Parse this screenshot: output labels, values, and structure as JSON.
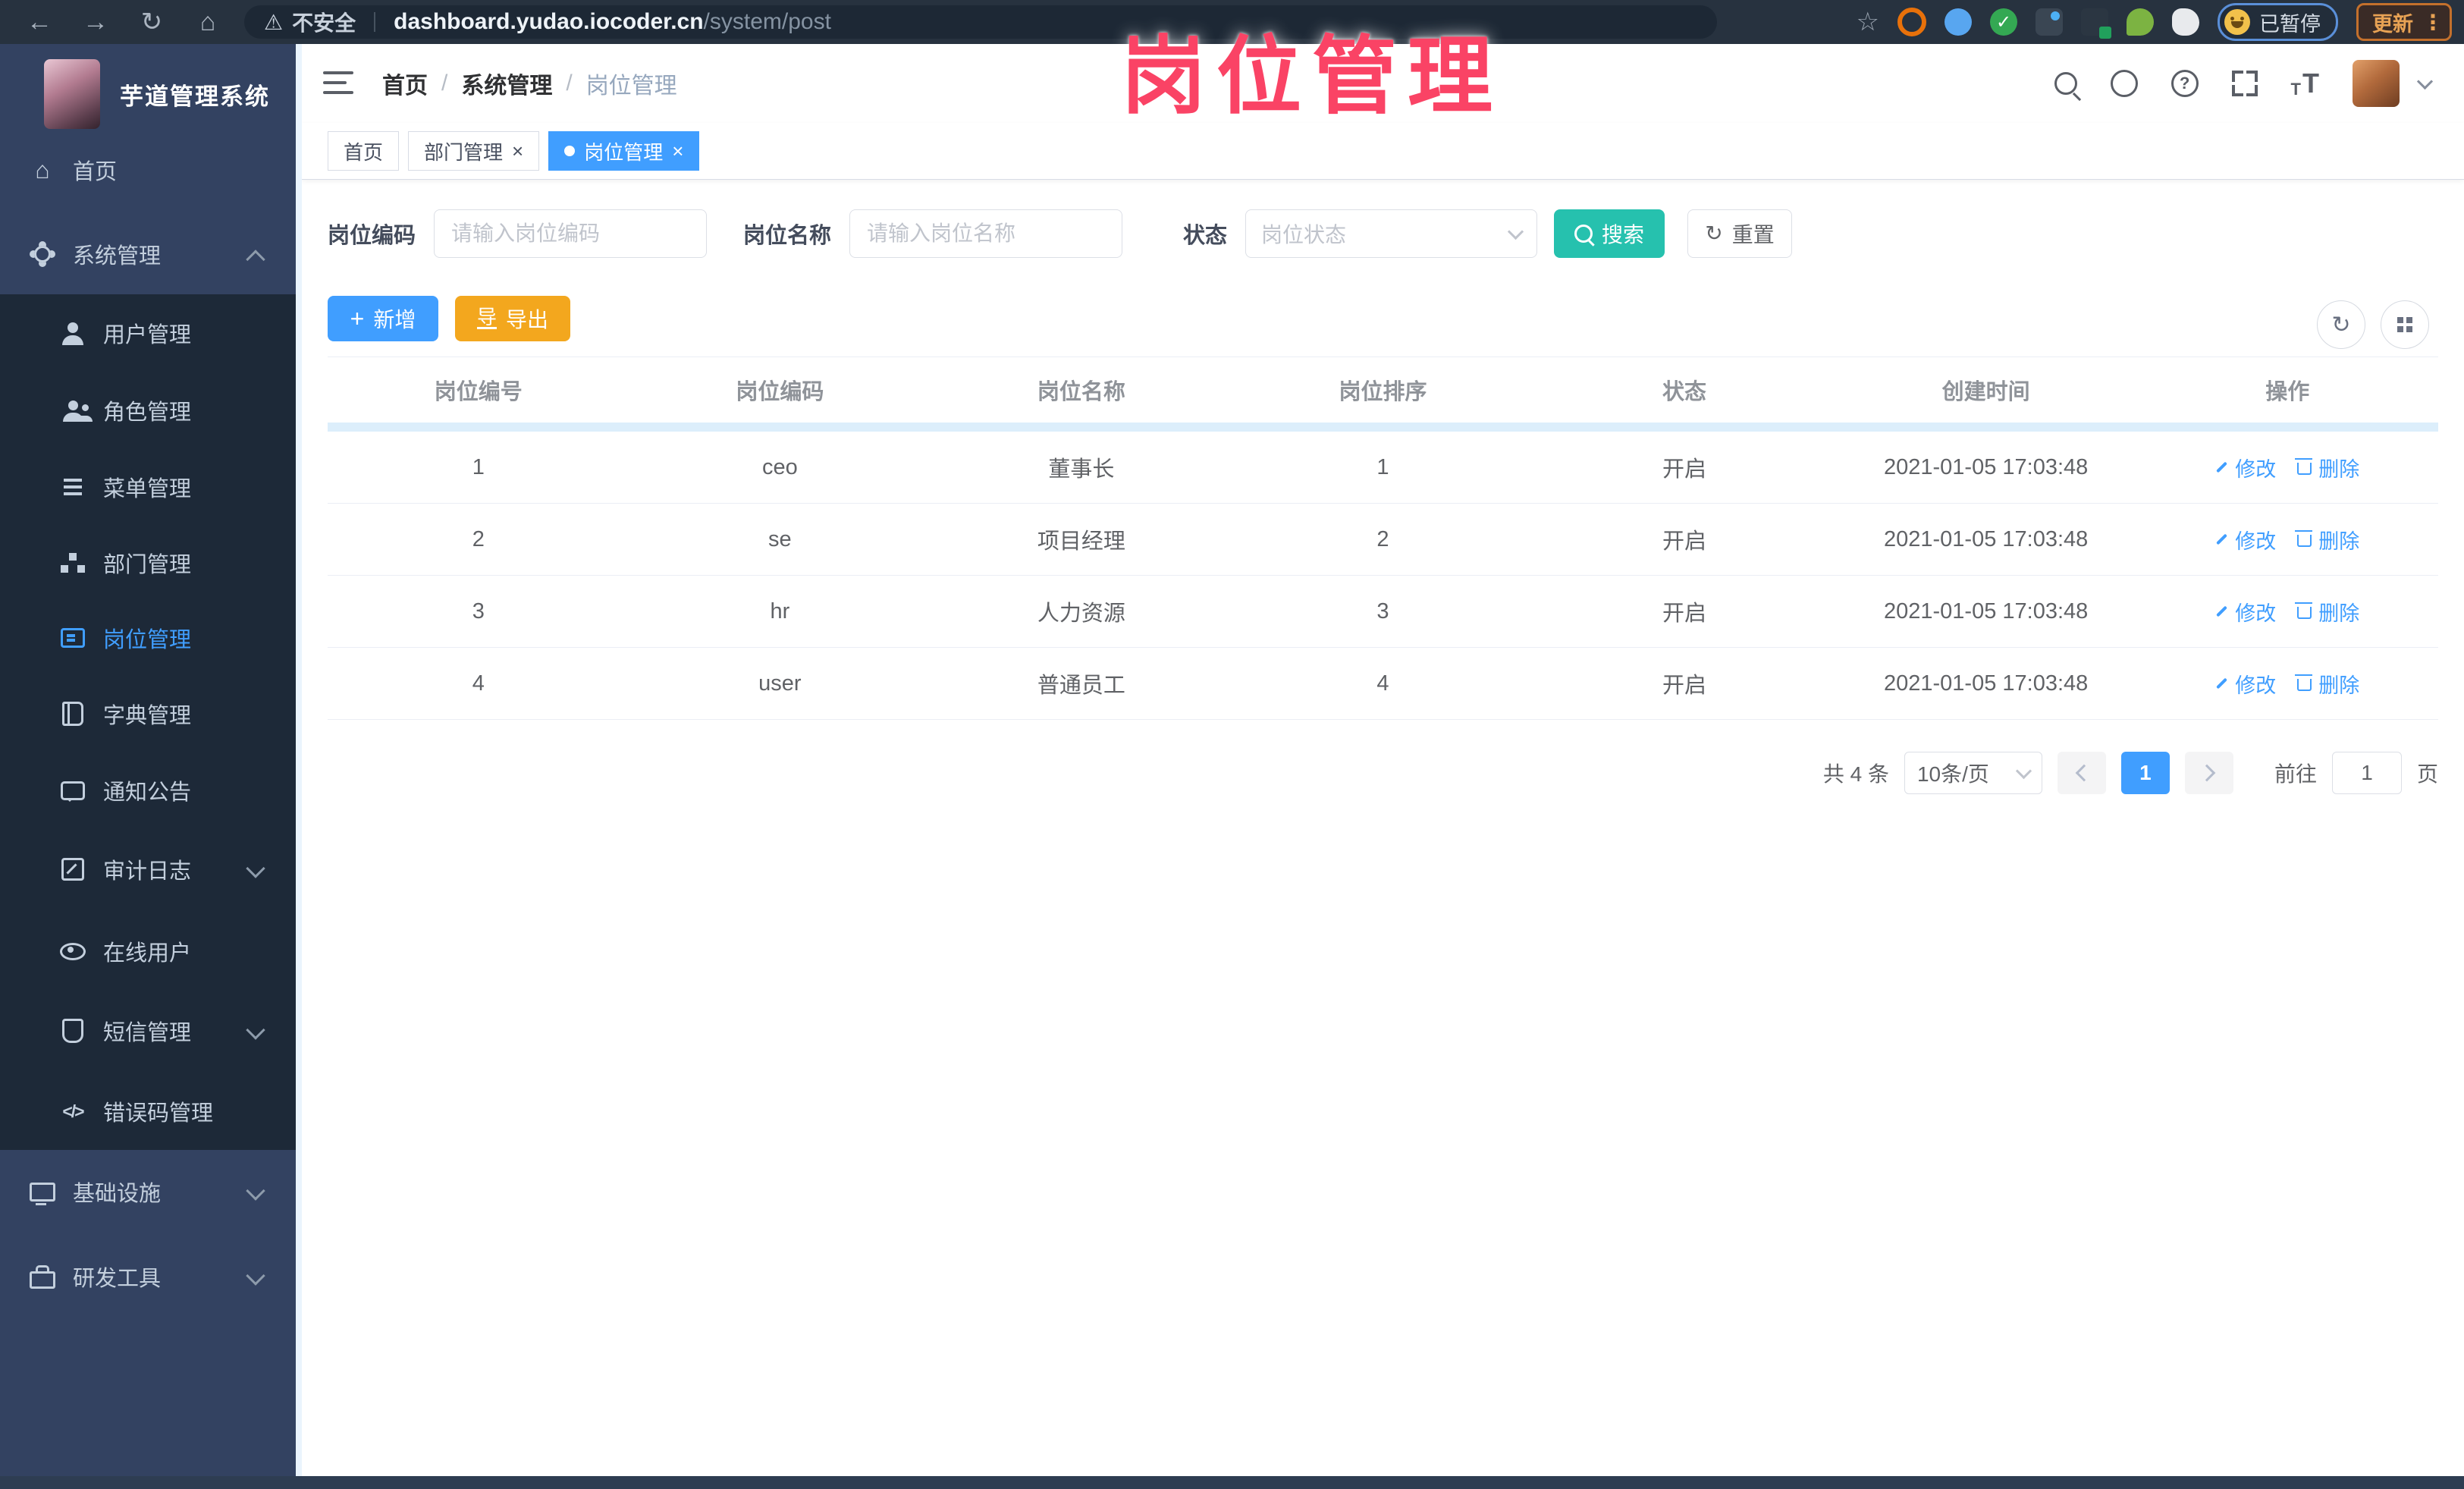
{
  "browser": {
    "security_label": "不安全",
    "url_host": "dashboard.yudao.iocoder.cn",
    "url_path": "/system/post",
    "paused_badge": "已暂停",
    "update_label": "更新"
  },
  "annotation": {
    "text": "岗位管理",
    "color": "#FA4365"
  },
  "sidebar": {
    "logo_title": "芋道管理系统",
    "home": "首页",
    "system": "系统管理",
    "children": [
      "用户管理",
      "角色管理",
      "菜单管理",
      "部门管理",
      "岗位管理",
      "字典管理",
      "通知公告",
      "审计日志",
      "在线用户",
      "短信管理",
      "错误码管理"
    ],
    "active_item": "岗位管理",
    "infra": "基础设施",
    "devtools": "研发工具"
  },
  "header": {
    "breadcrumb": [
      "首页",
      "系统管理",
      "岗位管理"
    ]
  },
  "tabs": [
    {
      "label": "首页",
      "active": false,
      "closable": false
    },
    {
      "label": "部门管理",
      "active": false,
      "closable": true
    },
    {
      "label": "岗位管理",
      "active": true,
      "closable": true
    }
  ],
  "filters": {
    "code_label": "岗位编码",
    "code_placeholder": "请输入岗位编码",
    "name_label": "岗位名称",
    "name_placeholder": "请输入岗位名称",
    "status_label": "状态",
    "status_placeholder": "岗位状态",
    "search_label": "搜索",
    "reset_label": "重置"
  },
  "toolbar": {
    "add_label": "新增",
    "export_label": "导出"
  },
  "table": {
    "headers": [
      "岗位编号",
      "岗位编码",
      "岗位名称",
      "岗位排序",
      "状态",
      "创建时间",
      "操作"
    ],
    "rows": [
      {
        "no": "1",
        "code": "ceo",
        "name": "董事长",
        "sort": "1",
        "status": "开启",
        "created": "2021-01-05 17:03:48"
      },
      {
        "no": "2",
        "code": "se",
        "name": "项目经理",
        "sort": "2",
        "status": "开启",
        "created": "2021-01-05 17:03:48"
      },
      {
        "no": "3",
        "code": "hr",
        "name": "人力资源",
        "sort": "3",
        "status": "开启",
        "created": "2021-01-05 17:03:48"
      },
      {
        "no": "4",
        "code": "user",
        "name": "普通员工",
        "sort": "4",
        "status": "开启",
        "created": "2021-01-05 17:03:48"
      }
    ],
    "edit_label": "修改",
    "delete_label": "删除"
  },
  "pagination": {
    "total": "共 4 条",
    "page_size": "10条/页",
    "current_page": "1",
    "goto_label": "前往",
    "goto_value": "1",
    "page_unit": "页"
  },
  "colors": {
    "accent": "#409EFF",
    "search_button": "#26C1AE",
    "export_button": "#F3A71E",
    "annotation": "#FA4365",
    "sidebar_bg": "#334261",
    "submenu_bg": "#1D2938"
  },
  "icons": {
    "back": "←",
    "forward": "→",
    "reload": "↻",
    "home": "⌂",
    "warning": "⚠",
    "star": "☆",
    "kebab": "⋮",
    "check": "✓",
    "plus": "+",
    "download": "导",
    "refresh": "↻",
    "close": "×",
    "question": "?",
    "slash": "/",
    "code": "</>"
  }
}
